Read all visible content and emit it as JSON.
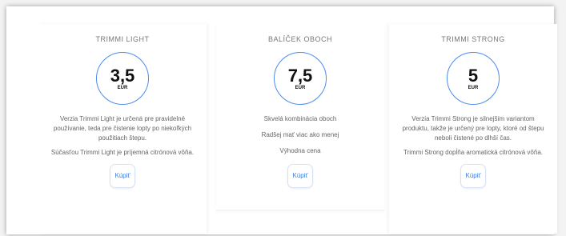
{
  "plans": [
    {
      "title": "TRIMMI LIGHT",
      "price": "3,5",
      "currency": "EUR",
      "paragraphs": [
        "Verzia Trimmi Light je určená pre pravidelné používanie, teda pre čistenie lopty po niekoľkých použitiach štepu.",
        "Súčasťou Trimmi Light je príjemná citrónová vôňa."
      ],
      "button": "Kúpiť"
    },
    {
      "title": "BALÍČEK OBOCH",
      "price": "7,5",
      "currency": "EUR",
      "paragraphs": [
        "Skvelá kombinácia oboch",
        "Radšej mať viac ako menej",
        "Výhodna cena"
      ],
      "button": "Kúpiť"
    },
    {
      "title": "TRIMMI STRONG",
      "price": "5",
      "currency": "EUR",
      "paragraphs": [
        "Verzia Trimmi Strong je silnejším variantom produktu, takže je určený pre lopty, ktoré od štepu neboli čistené po dlhší čas.",
        "Trimmi Strong dopĺňa aromatická citrónová vôňa."
      ],
      "button": "Kúpiť"
    }
  ],
  "colors": {
    "accent": "#4a8cf0",
    "button_text": "#3a7de0"
  }
}
